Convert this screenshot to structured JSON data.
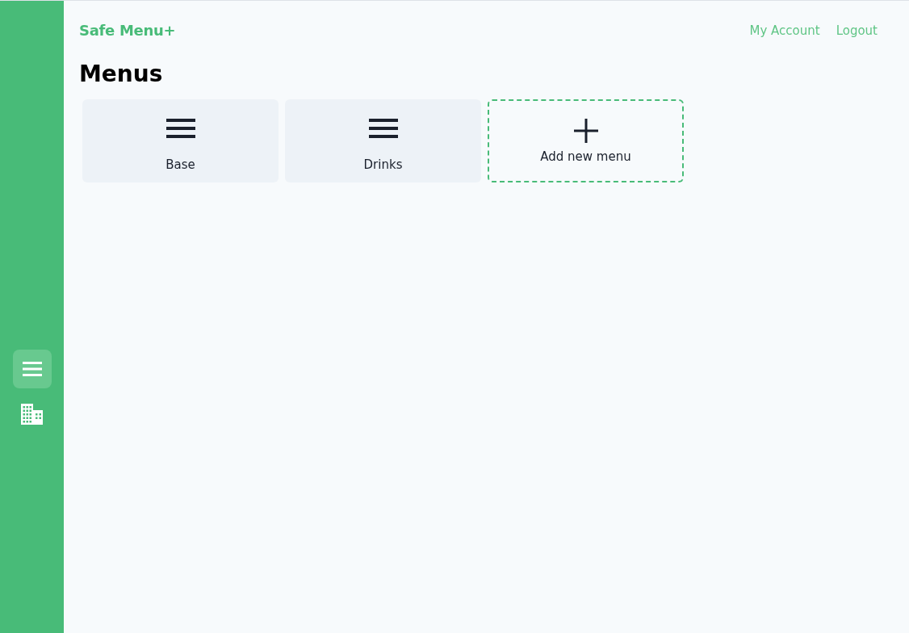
{
  "app": {
    "title": "Safe Menu+"
  },
  "header_links": [
    {
      "label": "My Account"
    },
    {
      "label": "Logout"
    }
  ],
  "sidebar": {
    "items": [
      {
        "kind": "menu",
        "selected": true
      },
      {
        "kind": "building",
        "selected": false
      }
    ]
  },
  "page_title": "Menus",
  "menus": [
    {
      "name": "Base"
    },
    {
      "name": "Drinks"
    }
  ],
  "add_card": {
    "label": "Add new menu"
  }
}
